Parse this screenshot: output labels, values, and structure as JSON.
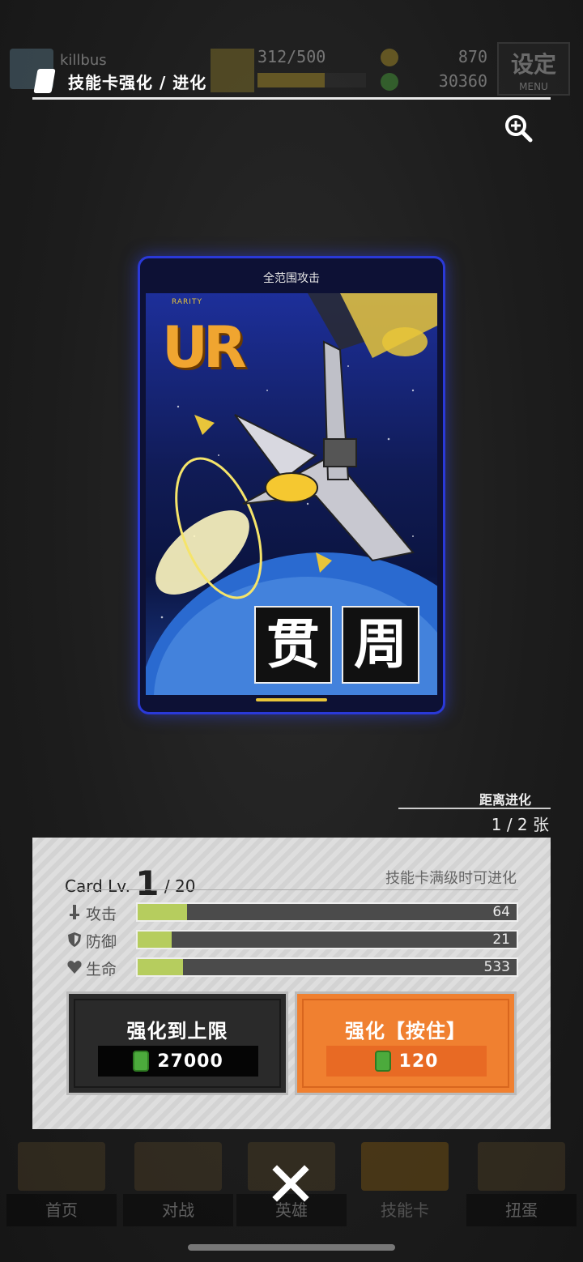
{
  "topbar": {
    "username": "killbus",
    "stamina": "312/500",
    "stamina_fraction": 0.62,
    "currency_gold": "870",
    "currency_green": "30360",
    "menu_main": "设定",
    "menu_sub": "MENU"
  },
  "header": {
    "breadcrumb": "技能卡强化 / 进化"
  },
  "card": {
    "category": "全范围攻击",
    "rarity_caption": "RARITY",
    "rarity": "UR",
    "title_char_1": "贯",
    "title_char_2": "周"
  },
  "evolution": {
    "label": "距离进化",
    "count": "1 / 2 张"
  },
  "panel": {
    "level_prefix": "Card Lv.",
    "level": "1",
    "level_max": "/ 20",
    "note": "技能卡满级时可进化",
    "stats": [
      {
        "name": "攻击",
        "value": "64",
        "fill": 0.13,
        "icon": "sword-icon"
      },
      {
        "name": "防御",
        "value": "21",
        "fill": 0.09,
        "icon": "shield-icon"
      },
      {
        "name": "生命",
        "value": "533",
        "fill": 0.12,
        "icon": "heart-icon"
      }
    ],
    "btn_max_label": "强化到上限",
    "btn_max_cost": "27000",
    "btn_up_label": "强化【按住】",
    "btn_up_cost": "120"
  },
  "nav": {
    "items": [
      {
        "label": "首页"
      },
      {
        "label": "对战"
      },
      {
        "label": "英雄"
      },
      {
        "label": "技能卡"
      },
      {
        "label": "扭蛋"
      }
    ]
  },
  "colors": {
    "accent_orange": "#f08030",
    "stat_fill": "#b6cd5e",
    "card_border": "#2a39d8",
    "rarity_gold": "#f0a530"
  }
}
